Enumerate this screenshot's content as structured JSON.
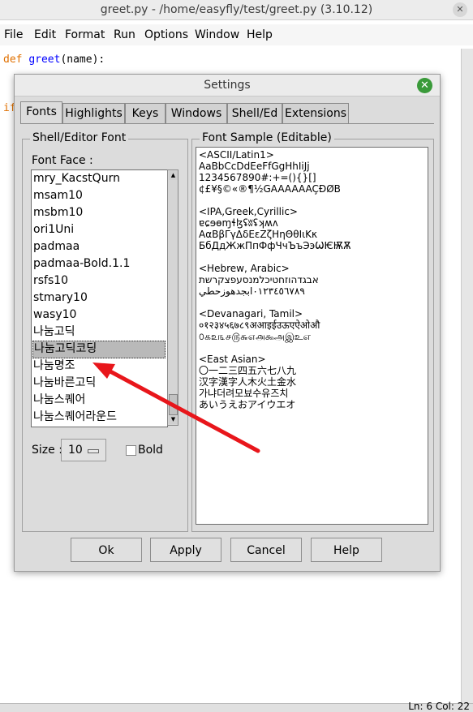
{
  "window": {
    "title": "greet.py - /home/easyfly/test/greet.py (3.10.12)",
    "close_glyph": "✕"
  },
  "menu": [
    "File",
    "Edit",
    "Format",
    "Run",
    "Options",
    "Window",
    "Help"
  ],
  "menu_mnemonics": [
    "F",
    "E",
    "o",
    "R",
    "O",
    "W",
    "H"
  ],
  "editor": {
    "line1_kw": "def",
    "line1_fn": "greet",
    "line1_rest": "(name):",
    "line3_kw": "if"
  },
  "status": {
    "text": "Ln: 6  Col: 22"
  },
  "dialog": {
    "title": "Settings",
    "close_glyph": "✕",
    "tabs": [
      "Fonts",
      "Highlights",
      "Keys",
      "Windows",
      "Shell/Ed",
      "Extensions"
    ],
    "active_tab": "Fonts",
    "font_group_title": "Shell/Editor Font",
    "font_face_label": "Font Face :",
    "fonts": [
      "mry_KacstQurn",
      "msam10",
      "msbm10",
      "ori1Uni",
      "padmaa",
      "padmaa-Bold.1.1",
      "rsfs10",
      "stmary10",
      "wasy10",
      "나눔고딕",
      "나눔고딕코딩",
      "나눔명조",
      "나눔바른고딕",
      "나눔스퀘어",
      "나눔스퀘어라운드"
    ],
    "selected_font": "나눔고딕코딩",
    "size_label": "Size :",
    "size_value": "10",
    "bold_label": "Bold",
    "bold_checked": false,
    "sample_group_title": "Font Sample (Editable)",
    "sample_lines": [
      "<ASCII/Latin1>",
      "AaBbCcDdEeFfGgHhIiJj",
      "1234567890#:+=(){}[]",
      "¢£¥§©«®¶½GAAAAAAÇÐØB",
      "",
      "<IPA,Greek,Cyrillic>",
      "ɐɕɘɵɱɬɮʢʬʢʞʍʌ",
      "ΑαΒβΓγΔδΕεΖζΗηΘθΙιΚκ",
      "БбДдЖжПпФфЧчЪъЭэѠѤѬѪ",
      "",
      "<Hebrew, Arabic>",
      "אבגדהוזחטיכלמנסעפצקרשת",
      "٠١٢٣٤٥٦٧٨٩ابجدهوزحطي",
      "",
      "<Devanagari, Tamil>",
      "०१२३४५६७८९अआइईउऊएऐओऔ",
      "௦௧௨௩௪௫௬௭௮௯அஇஉஎ",
      "",
      "<East Asian>",
      "〇一二三四五六七八九",
      "汉字漢字人木火土金水",
      "가냐더려모뵤수유즈치",
      "あいうえおアイウエオ"
    ],
    "buttons": {
      "ok": "Ok",
      "apply": "Apply",
      "cancel": "Cancel",
      "help": "Help"
    }
  },
  "annotation": {
    "color": "#e8161b"
  },
  "icons": {
    "scroll_up": "▲",
    "scroll_down": "▼"
  }
}
